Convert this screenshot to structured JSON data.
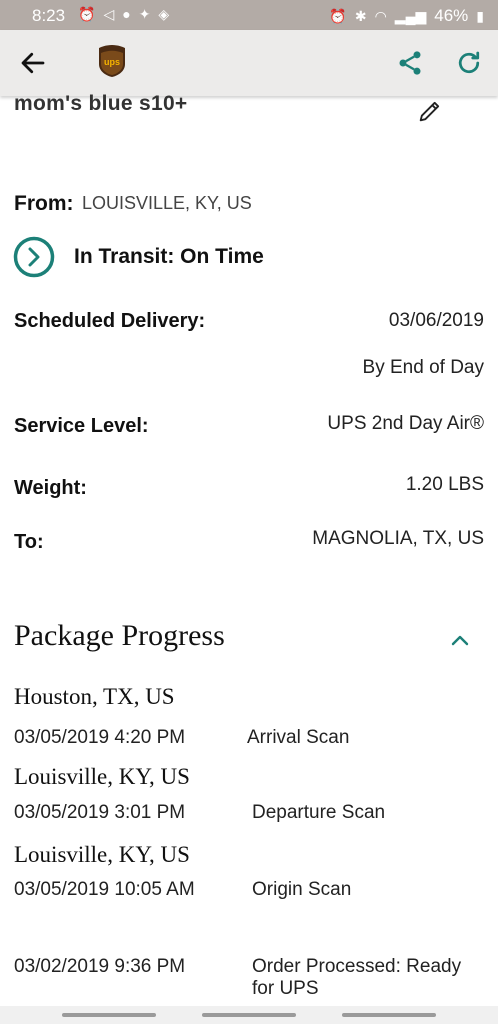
{
  "status_bar": {
    "time": "8:23",
    "battery": "46%",
    "icons_left": [
      "alarm-icon",
      "volume-icon",
      "notification-icon",
      "twitter-icon",
      "wifi-shield-icon"
    ],
    "icons_right": [
      "alarm-icon",
      "bluetooth-icon",
      "wifi-icon",
      "signal-icon",
      "battery-icon"
    ]
  },
  "app_bar": {
    "logo_text": "ups",
    "back_icon": "arrow-left-icon",
    "share_icon": "share-icon",
    "refresh_icon": "refresh-icon",
    "accent": "#1c8078"
  },
  "package": {
    "nickname": "mom's blue s10+",
    "from_label": "From:",
    "from_value": "LOUISVILLE, KY, US",
    "status": "In Transit: On Time",
    "details": [
      {
        "label": "Scheduled Delivery:",
        "value": "03/06/2019",
        "sub": "By End of Day"
      },
      {
        "label": "Service Level:",
        "value": "UPS 2nd Day Air®"
      },
      {
        "label": "Weight:",
        "value": "1.20  LBS"
      },
      {
        "label": "To:",
        "value": "MAGNOLIA, TX, US"
      }
    ]
  },
  "progress": {
    "title": "Package Progress",
    "groups": [
      {
        "location": "Houston, TX, US",
        "events": [
          {
            "datetime": "03/05/2019  4:20 PM",
            "description": "Arrival Scan"
          }
        ]
      },
      {
        "location": "Louisville, KY, US",
        "events": [
          {
            "datetime": "03/05/2019  3:01 PM",
            "description": "Departure Scan"
          }
        ]
      },
      {
        "location": "Louisville, KY, US",
        "events": [
          {
            "datetime": "03/05/2019  10:05 AM",
            "description": "Origin Scan"
          },
          {
            "datetime": "03/02/2019  9:36 PM",
            "description": "Order Processed: Ready for UPS"
          }
        ]
      }
    ]
  }
}
